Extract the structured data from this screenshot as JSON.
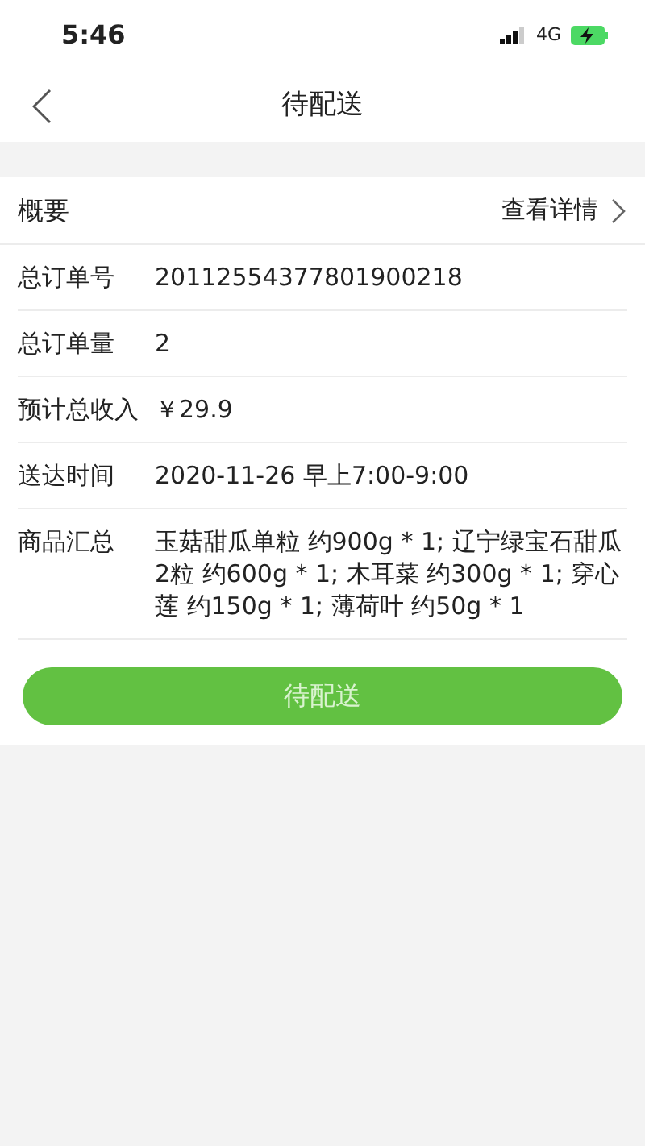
{
  "status_bar": {
    "time": "5:46",
    "network": "4G"
  },
  "nav": {
    "title": "待配送"
  },
  "summary": {
    "label": "概要",
    "link": "查看详情"
  },
  "rows": [
    {
      "label": "总订单号",
      "value": "20112554377801900218"
    },
    {
      "label": "总订单量",
      "value": "2"
    },
    {
      "label": "预计总收入",
      "value": "￥29.9"
    },
    {
      "label": "送达时间",
      "value": "2020-11-26 早上7:00-9:00"
    },
    {
      "label": "商品汇总",
      "value": "玉菇甜瓜单粒 约900g * 1; 辽宁绿宝石甜瓜2粒 约600g * 1; 木耳菜 约300g * 1; 穿心莲 约150g * 1; 薄荷叶 约50g * 1"
    }
  ],
  "action_button": {
    "label": "待配送"
  }
}
